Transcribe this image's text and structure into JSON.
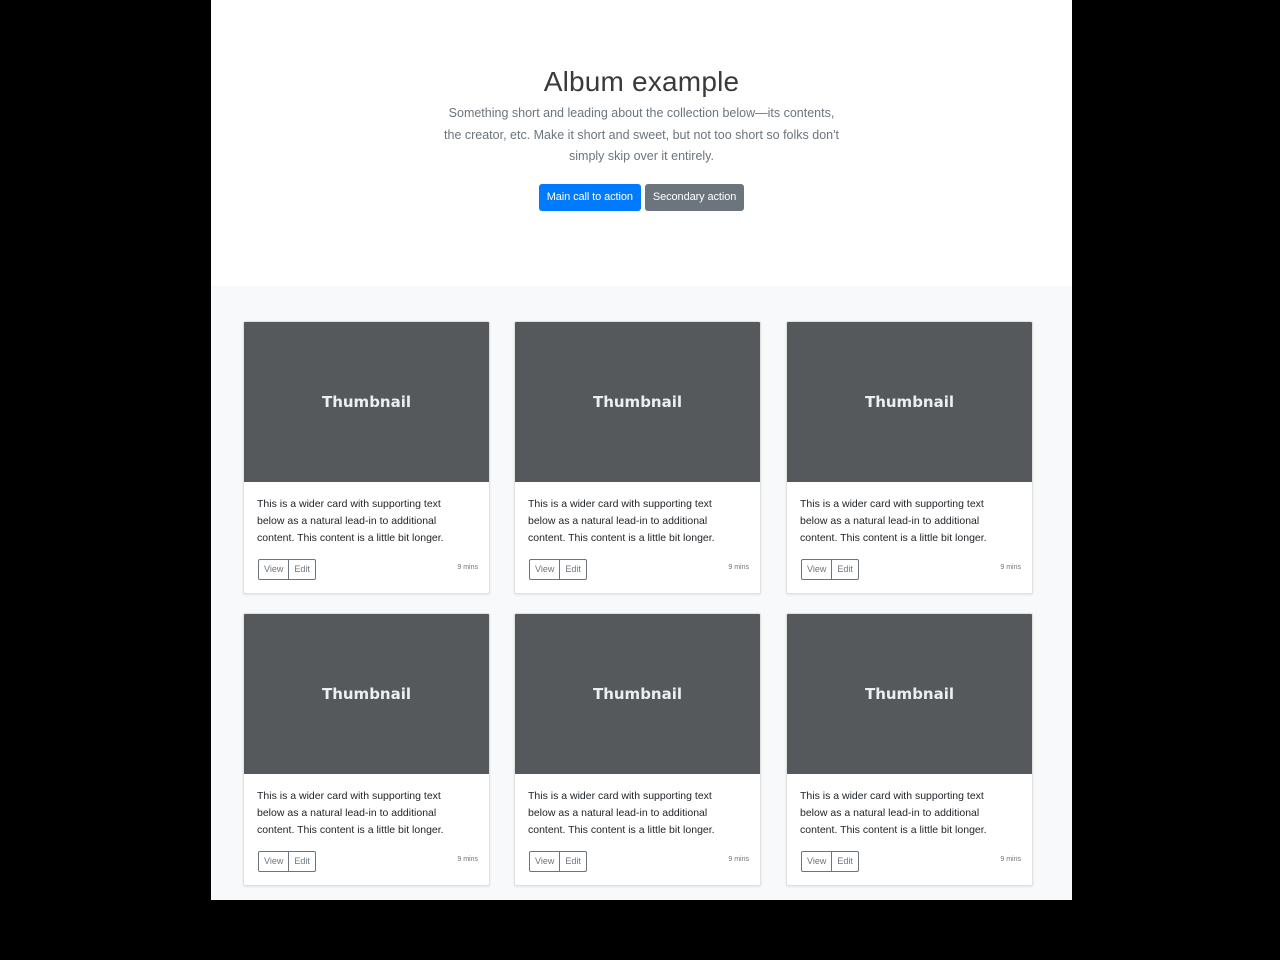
{
  "jumbotron": {
    "title": "Album example",
    "lead_lines": [
      "Something short and leading about the collection below—its contents,",
      "the creator, etc. Make it short and sweet, but not too short so folks don't",
      "simply skip over it entirely."
    ],
    "primary_button": "Main call to action",
    "secondary_button": "Secondary action"
  },
  "colors": {
    "primary": "#007bff",
    "secondary": "#6c757d",
    "thumbnail": "#55595c",
    "album_background": "#f8f9fa"
  },
  "cards": [
    {
      "thumbnail": "Thumbnail",
      "text_lines": [
        "This is a wider card with supporting text",
        "below as a natural lead-in to additional",
        "content. This content is a little bit longer."
      ],
      "view": "View",
      "edit": "Edit",
      "time": "9 mins"
    },
    {
      "thumbnail": "Thumbnail",
      "text_lines": [
        "This is a wider card with supporting text",
        "below as a natural lead-in to additional",
        "content. This content is a little bit longer."
      ],
      "view": "View",
      "edit": "Edit",
      "time": "9 mins"
    },
    {
      "thumbnail": "Thumbnail",
      "text_lines": [
        "This is a wider card with supporting text",
        "below as a natural lead-in to additional",
        "content. This content is a little bit longer."
      ],
      "view": "View",
      "edit": "Edit",
      "time": "9 mins"
    },
    {
      "thumbnail": "Thumbnail",
      "text_lines": [
        "This is a wider card with supporting text",
        "below as a natural lead-in to additional",
        "content. This content is a little bit longer."
      ],
      "view": "View",
      "edit": "Edit",
      "time": "9 mins"
    },
    {
      "thumbnail": "Thumbnail",
      "text_lines": [
        "This is a wider card with supporting text",
        "below as a natural lead-in to additional",
        "content. This content is a little bit longer."
      ],
      "view": "View",
      "edit": "Edit",
      "time": "9 mins"
    },
    {
      "thumbnail": "Thumbnail",
      "text_lines": [
        "This is a wider card with supporting text",
        "below as a natural lead-in to additional",
        "content. This content is a little bit longer."
      ],
      "view": "View",
      "edit": "Edit",
      "time": "9 mins"
    }
  ]
}
